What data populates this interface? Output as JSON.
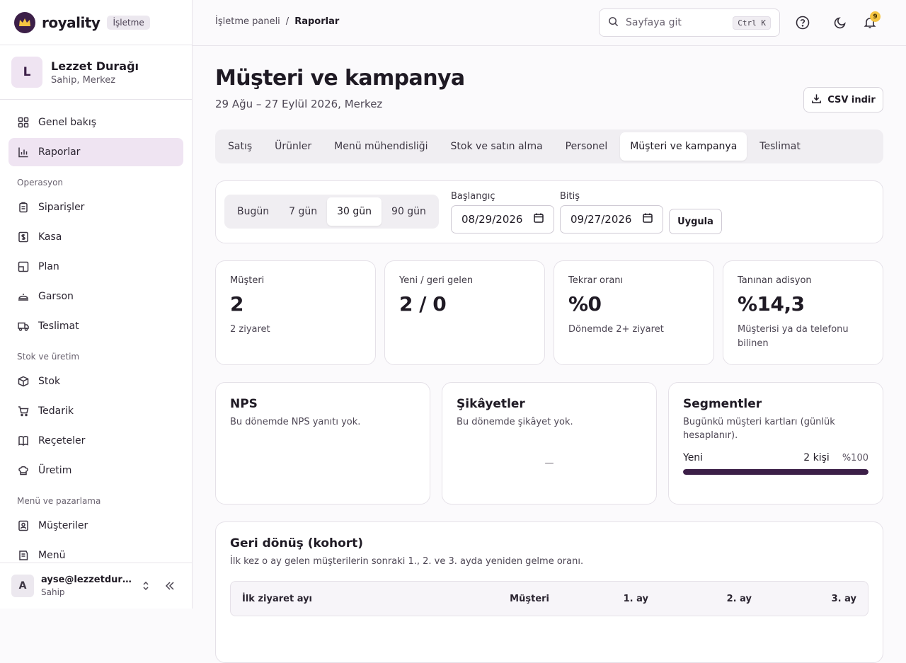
{
  "brand": {
    "name": "royality",
    "badge": "İşletme"
  },
  "org": {
    "initial": "L",
    "name": "Lezzet Durağı",
    "sub": "Sahip, Merkez"
  },
  "nav": {
    "top": [
      {
        "label": "Genel bakış",
        "icon": "grid-icon"
      },
      {
        "label": "Raporlar",
        "icon": "bar-chart-icon",
        "active": true
      }
    ],
    "sections": [
      {
        "title": "Operasyon",
        "items": [
          {
            "label": "Siparişler",
            "icon": "clipboard-icon"
          },
          {
            "label": "Kasa",
            "icon": "cash-register-icon"
          },
          {
            "label": "Plan",
            "icon": "floor-plan-icon"
          },
          {
            "label": "Garson",
            "icon": "waiter-icon"
          },
          {
            "label": "Teslimat",
            "icon": "truck-icon"
          }
        ]
      },
      {
        "title": "Stok ve üretim",
        "items": [
          {
            "label": "Stok",
            "icon": "box-icon"
          },
          {
            "label": "Tedarik",
            "icon": "cart-icon"
          },
          {
            "label": "Reçeteler",
            "icon": "book-icon"
          },
          {
            "label": "Üretim",
            "icon": "chef-hat-icon"
          }
        ]
      },
      {
        "title": "Menü ve pazarlama",
        "items": [
          {
            "label": "Müşteriler",
            "icon": "contact-icon"
          },
          {
            "label": "Menü",
            "icon": "menu-book-icon"
          }
        ]
      }
    ]
  },
  "user": {
    "initial": "A",
    "email": "ayse@lezzetduragi.com",
    "role": "Sahip"
  },
  "topbar": {
    "breadcrumb": [
      "İşletme paneli",
      "Raporlar"
    ],
    "search_placeholder": "Sayfaya git",
    "shortcut": "Ctrl K",
    "notification_count": "9"
  },
  "page": {
    "title": "Müşteri ve kampanya",
    "subtitle": "29 Ağu – 27 Eylül 2026, Merkez",
    "csv_label": "CSV indir"
  },
  "tabs": [
    "Satış",
    "Ürünler",
    "Menü mühendisliği",
    "Stok ve satın alma",
    "Personel",
    "Müşteri ve kampanya",
    "Teslimat"
  ],
  "active_tab": 5,
  "range": {
    "presets": [
      "Bugün",
      "7 gün",
      "30 gün",
      "90 gün"
    ],
    "active_preset": 2,
    "start_label": "Başlangıç",
    "start_value": "08/29/2026",
    "end_label": "Bitiş",
    "end_value": "09/27/2026",
    "apply_label": "Uygula"
  },
  "stats": [
    {
      "label": "Müşteri",
      "value": "2",
      "note": "2 ziyaret"
    },
    {
      "label": "Yeni / geri gelen",
      "value": "2 / 0",
      "note": ""
    },
    {
      "label": "Tekrar oranı",
      "value": "%0",
      "note": "Dönemde 2+ ziyaret"
    },
    {
      "label": "Tanınan adisyon",
      "value": "%14,3",
      "note": "Müşterisi ya da telefonu bilinen"
    }
  ],
  "nps": {
    "title": "NPS",
    "sub": "Bu dönemde NPS yanıtı yok."
  },
  "complaints": {
    "title": "Şikâyetler",
    "sub": "Bu dönemde şikâyet yok.",
    "empty": "—"
  },
  "segments": {
    "title": "Segmentler",
    "sub": "Bugünkü müşteri kartları (günlük hesaplanır).",
    "rows": [
      {
        "name": "Yeni",
        "count": "2 kişi",
        "percent": "%100",
        "fraction": 1.0
      }
    ]
  },
  "cohort": {
    "title": "Geri dönüş (kohort)",
    "sub": "İlk kez o ay gelen müşterilerin sonraki 1., 2. ve 3. ayda yeniden gelme oranı.",
    "columns": [
      "İlk ziyaret ayı",
      "Müşteri",
      "1. ay",
      "2. ay",
      "3. ay"
    ]
  },
  "colors": {
    "accent": "#3c1f48",
    "accent_soft": "#efe4f2",
    "badge": "#f5c542"
  }
}
